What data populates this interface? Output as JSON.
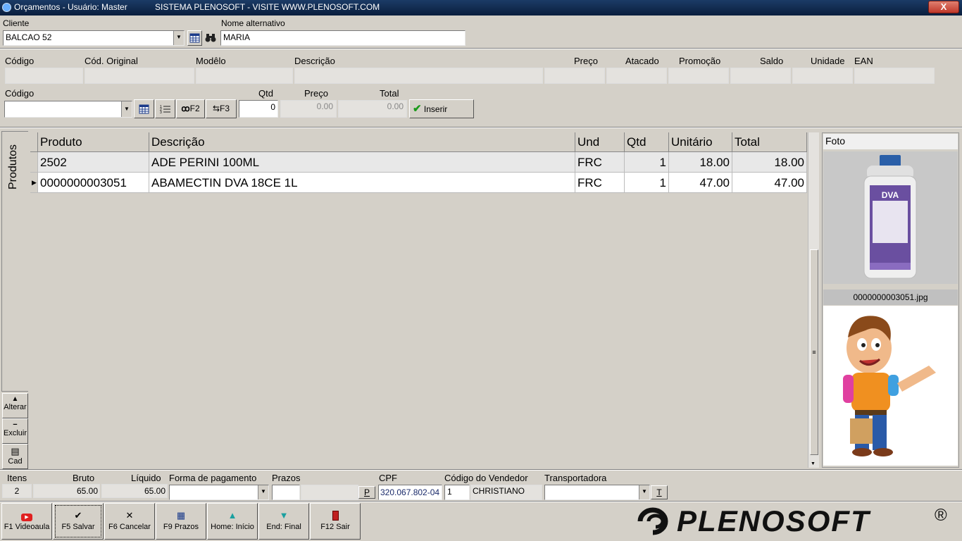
{
  "window": {
    "title": "Orçamentos - Usuário: Master",
    "subtitle": "SISTEMA PLENOSOFT - VISITE WWW.PLENOSOFT.COM",
    "close": "X"
  },
  "client": {
    "label": "Cliente",
    "value": "BALCAO 52",
    "alt_label": "Nome alternativo",
    "alt_value": "MARIA"
  },
  "info_headers": {
    "codigo": "Código",
    "cod_original": "Cód. Original",
    "modelo": "Modêlo",
    "descricao": "Descrição",
    "preco": "Preço",
    "atacado": "Atacado",
    "promocao": "Promoção",
    "saldo": "Saldo",
    "unidade": "Unidade",
    "ean": "EAN"
  },
  "entry": {
    "codigo_label": "Código",
    "qtd_label": "Qtd",
    "qtd_value": "0",
    "preco_label": "Preço",
    "preco_value": "0.00",
    "total_label": "Total",
    "total_value": "0.00",
    "inserir": "Inserir",
    "f2": "F2",
    "f3": "F3"
  },
  "side": {
    "tab": "Produtos",
    "alterar": "Alterar",
    "excluir": "Excluir",
    "cad": "Cad"
  },
  "grid": {
    "columns": [
      "Produto",
      "Descrição",
      "Und",
      "Qtd",
      "Unitário",
      "Total"
    ],
    "rows": [
      [
        "2502",
        "ADE PERINI 100ML",
        "FRC",
        "1",
        "18.00",
        "18.00"
      ],
      [
        "0000000003051",
        "ABAMECTIN DVA 18CE 1L",
        "FRC",
        "1",
        "47.00",
        "47.00"
      ]
    ]
  },
  "photo": {
    "label": "Foto",
    "filename": "0000000003051.jpg",
    "brand": "DVA"
  },
  "totals": {
    "itens_label": "Itens",
    "itens": "2",
    "bruto_label": "Bruto",
    "bruto": "65.00",
    "liquido_label": "Líquido",
    "liquido": "65.00",
    "forma_label": "Forma de pagamento",
    "prazos_label": "Prazos",
    "prazos_btn": "P",
    "cpf_label": "CPF",
    "cpf": "320.067.802-04",
    "vendedor_label": "Código do Vendedor",
    "vendedor_code": "1",
    "vendedor_name": "CHRISTIANO",
    "transp_label": "Transportadora",
    "transp_btn": "T"
  },
  "footer": [
    "F1 Videoaula",
    "F5 Salvar",
    "F6 Cancelar",
    "F9 Prazos",
    "Home: Início",
    "End: Final",
    "F12 Sair"
  ],
  "logo": {
    "text": "PLENOSOFT",
    "reg": "®"
  },
  "colors": {
    "title_bg": "#0a1e3d",
    "face": "#d4d0c8",
    "check": "#1a9a1a",
    "youtube": "#e02020",
    "up_arrow": "#1aa0a0"
  }
}
